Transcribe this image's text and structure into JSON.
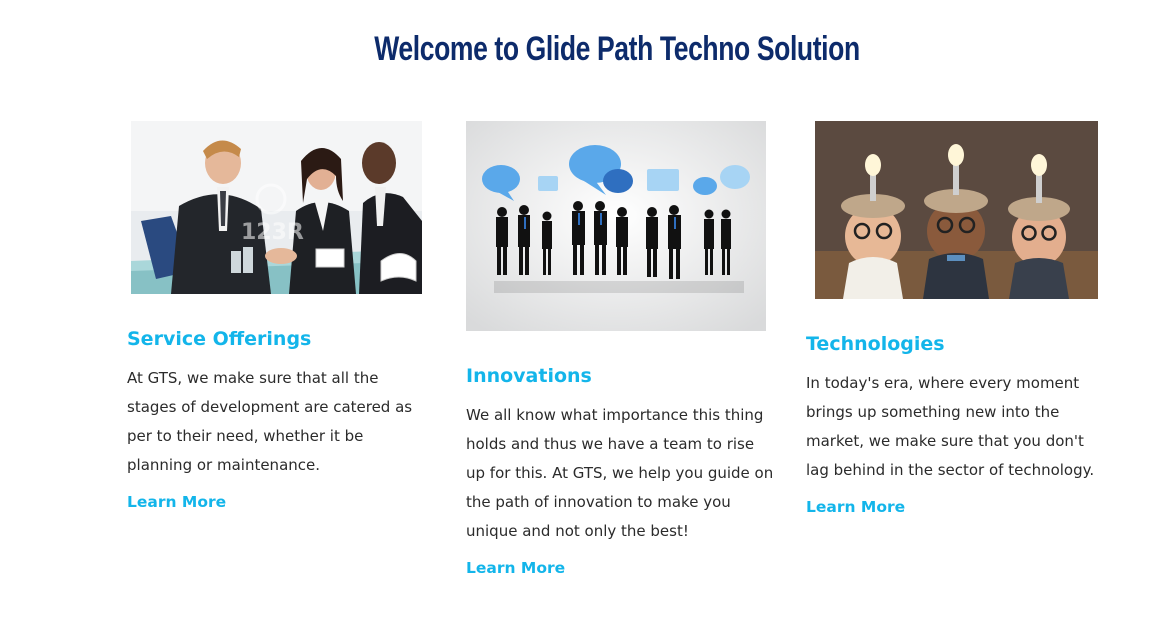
{
  "header": {
    "title": "Welcome to Glide Path Techno Solution"
  },
  "cards": [
    {
      "title": "Service Offerings",
      "body": "At GTS, we make sure that all the stages of development are catered as per to their need, whether it be planning or maintenance.",
      "link": "Learn More",
      "image_watermark": "123R"
    },
    {
      "title": "Innovations",
      "body": "We all know what importance this thing holds and thus we have a team to rise up for this. At GTS, we help you guide on the path of innovation to make you unique and not only the best!",
      "link": "Learn More"
    },
    {
      "title": "Technologies",
      "body": "In today's era, where every moment brings up something new into the market, we make sure that you don't lag behind in the sector of technology.",
      "link": "Learn More"
    }
  ],
  "colors": {
    "title": "#0d2b6b",
    "accent": "#13b5ea",
    "body_text": "#2b2b2b"
  }
}
